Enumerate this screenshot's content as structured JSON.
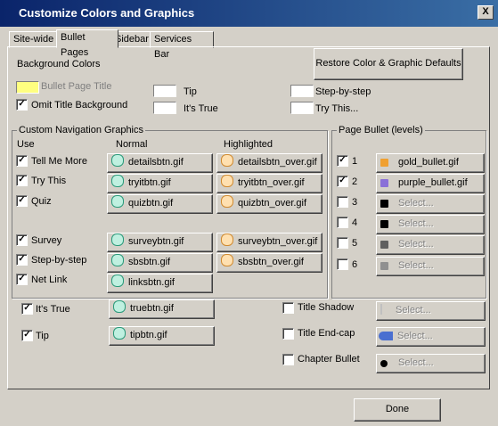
{
  "window": {
    "title": "Customize Colors and Graphics",
    "close_label": "X"
  },
  "tabs": [
    {
      "label": "Site-wide"
    },
    {
      "label": "Bullet Pages",
      "active": true
    },
    {
      "label": "Sidebar"
    },
    {
      "label": "Services Bar"
    }
  ],
  "background": {
    "section_label": "Background Colors",
    "restore_button": "Restore Color & Graphic Defaults",
    "bullet_page_title": "Bullet Page Title",
    "omit_title_bg": "Omit Title Background",
    "tip": "Tip",
    "its_true": "It's True",
    "step_by_step": "Step-by-step",
    "try_this": "Try This...",
    "bullet_page_title_color": "#ffff80"
  },
  "nav": {
    "group_label": "Custom Navigation Graphics",
    "col_use": "Use",
    "col_normal": "Normal",
    "col_highlighted": "Highlighted",
    "rows": [
      {
        "label": "Tell Me More",
        "normal": "detailsbtn.gif",
        "highlighted": "detailsbtn_over.gif"
      },
      {
        "label": "Try This",
        "normal": "tryitbtn.gif",
        "highlighted": "tryitbtn_over.gif"
      },
      {
        "label": "Quiz",
        "normal": "quizbtn.gif",
        "highlighted": "quizbtn_over.gif"
      },
      {
        "label": "Survey",
        "normal": "surveybtn.gif",
        "highlighted": "surveybtn_over.gif"
      },
      {
        "label": "Step-by-step",
        "normal": "sbsbtn.gif",
        "highlighted": "sbsbtn_over.gif"
      },
      {
        "label": "Net Link",
        "normal": "linksbtn.gif"
      }
    ],
    "its_true": {
      "label": "It's True",
      "normal": "truebtn.gif"
    },
    "tip": {
      "label": "Tip",
      "normal": "tipbtn.gif"
    }
  },
  "page_bullet": {
    "group_label": "Page Bullet (levels)",
    "levels": [
      {
        "num": "1",
        "file": "gold_bullet.gif",
        "checked": true
      },
      {
        "num": "2",
        "file": "purple_bullet.gif",
        "checked": true
      },
      {
        "num": "3",
        "file": "Select...",
        "checked": false
      },
      {
        "num": "4",
        "file": "Select...",
        "checked": false
      },
      {
        "num": "5",
        "file": "Select...",
        "checked": false
      },
      {
        "num": "6",
        "file": "Select...",
        "checked": false
      }
    ]
  },
  "extras": {
    "title_shadow": "Title Shadow",
    "title_endcap": "Title End-cap",
    "chapter_bullet": "Chapter Bullet",
    "select": "Select..."
  },
  "footer": {
    "done": "Done"
  }
}
